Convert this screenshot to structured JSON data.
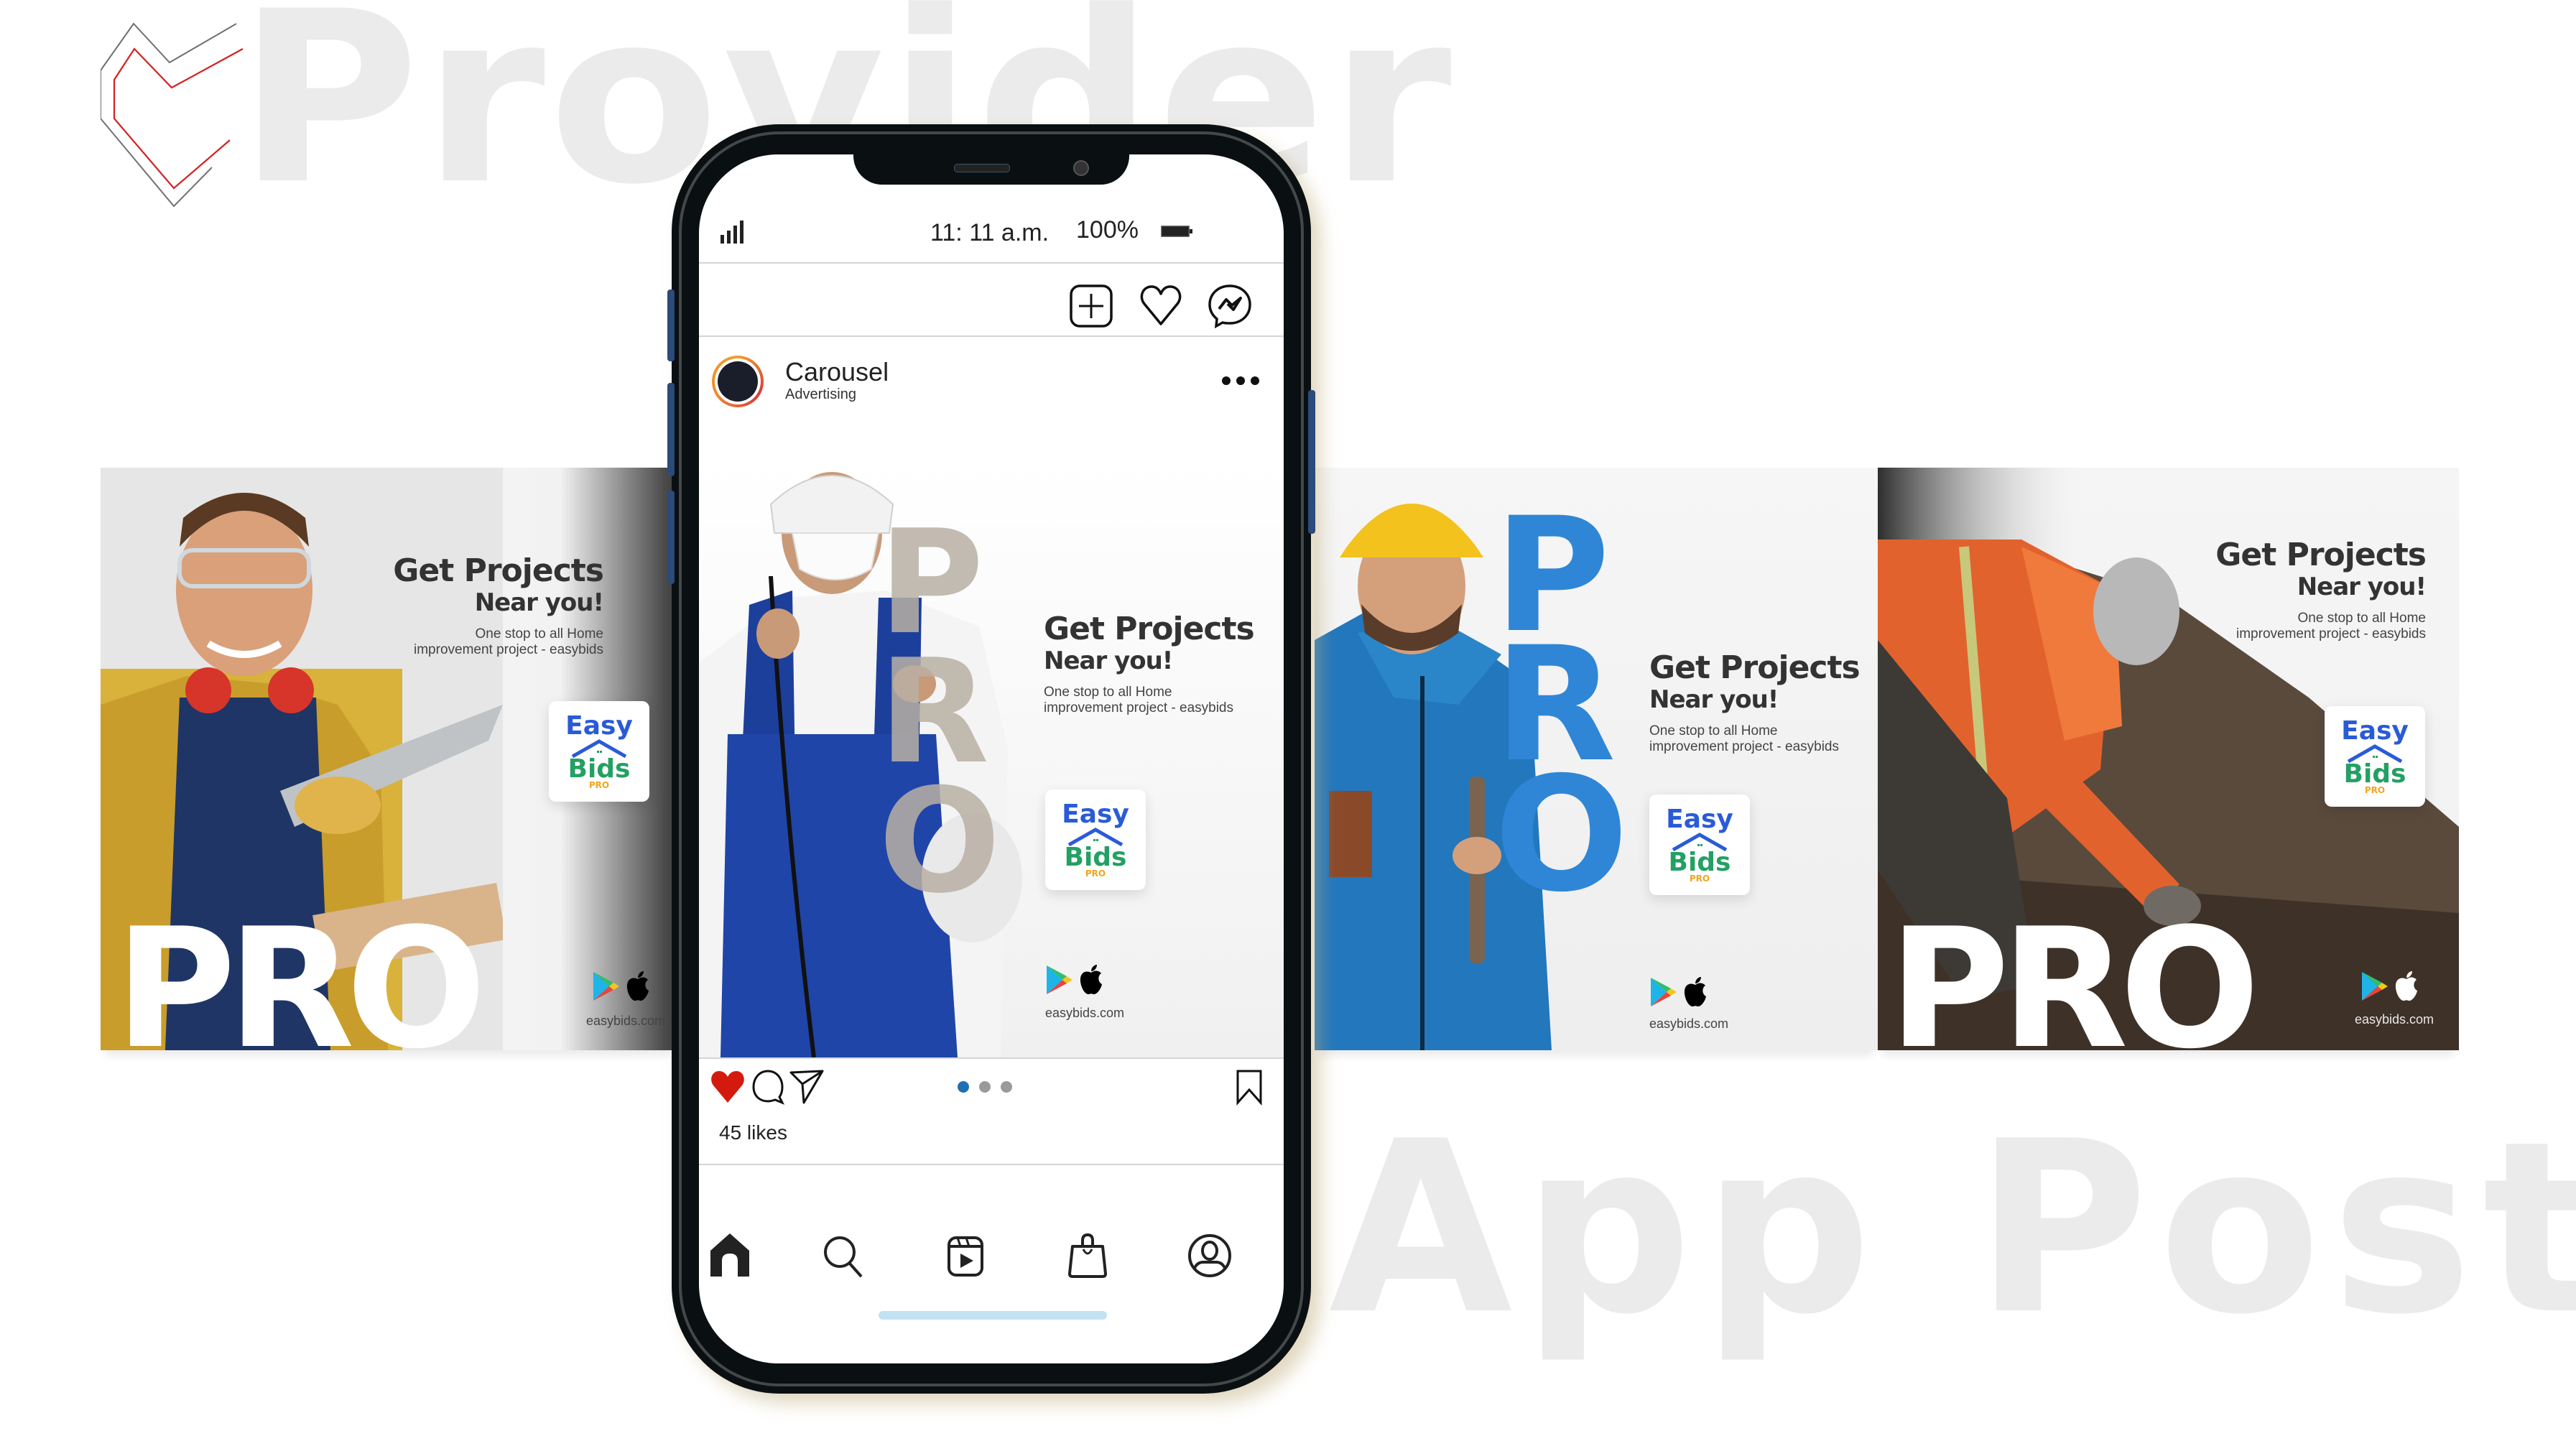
{
  "background": {
    "title_top": "Provider",
    "title_bottom": "App Post",
    "title_color": "#ebebeb"
  },
  "brand": {
    "logo_icon": "heart-outline-logo",
    "logo_colors": [
      "#707070",
      "#d42020"
    ]
  },
  "ad_copy": {
    "headline": "Get Projects",
    "subheadline": "Near you!",
    "tagline_line1": "One stop to all Home",
    "tagline_line2": "improvement project - easybids",
    "logo_easy": "Easy",
    "logo_bids": "Bids",
    "logo_pro": "PRO",
    "domain": "easybids.com",
    "pro_word": "PRO",
    "store_icons": [
      "google-play-icon",
      "apple-icon"
    ],
    "colors": {
      "easy": "#2a5bd7",
      "bids": "#23a063",
      "pro": "#f0a520",
      "pro_blue": "#2f86d6"
    }
  },
  "cards": [
    {
      "id": "card-1",
      "photo": "worker-with-saw-safety-glasses"
    },
    {
      "id": "card-2",
      "photo": "worker-with-sprayer-mask"
    },
    {
      "id": "card-3",
      "photo": "worker-with-wrench-hardhat"
    },
    {
      "id": "card-4",
      "photo": "worker-bending-hi-vis"
    }
  ],
  "phone": {
    "status": {
      "time": "11: 11 a.m.",
      "battery": "100%",
      "signal_icon": "signal-bars-icon",
      "battery_icon": "battery-icon"
    },
    "top_icons": [
      "new-post-icon",
      "heart-icon",
      "messenger-icon"
    ],
    "account": {
      "name": "Carousel",
      "subtitle": "Advertising"
    },
    "post": {
      "likes": "45 likes",
      "liked": true,
      "carousel_total": 3,
      "carousel_active": 1,
      "like_color": "#d41a0e",
      "active_dot_color": "#1f6fb2"
    },
    "bottom_nav": [
      "home",
      "search",
      "reels",
      "shop",
      "profile"
    ]
  }
}
